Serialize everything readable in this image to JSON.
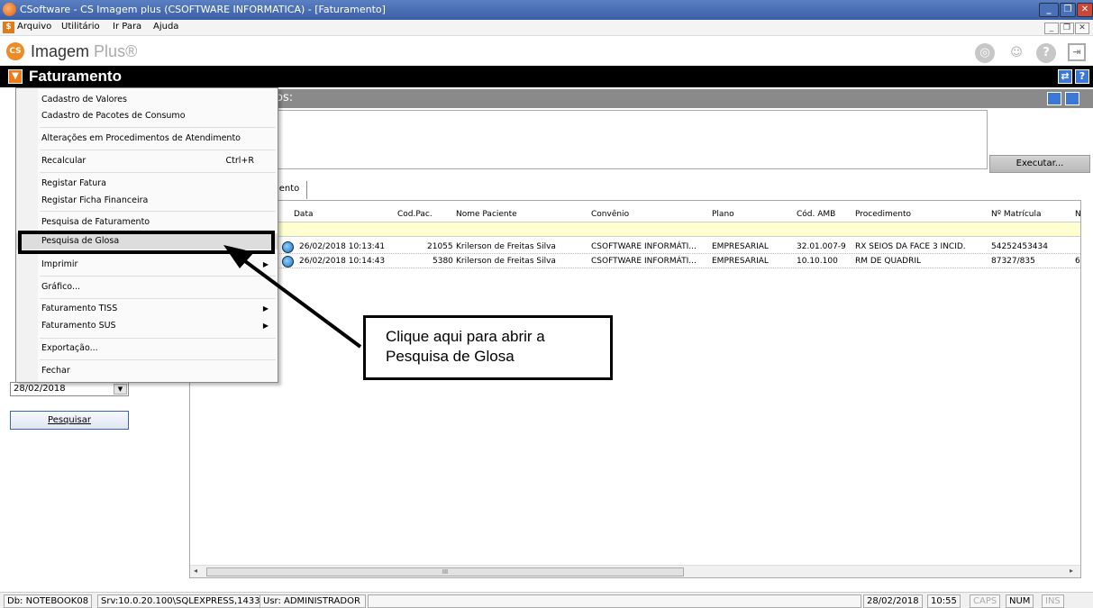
{
  "window": {
    "title": "CSoftware - CS Imagem plus (CSOFTWARE INFORMATICA) - [Faturamento]",
    "buttons": [
      "_",
      "❐",
      "✕"
    ]
  },
  "menubar": {
    "items": [
      "Arquivo",
      "Utilitário",
      "Ir Para",
      "Ajuda"
    ],
    "icon": "$",
    "mdi_buttons": [
      "_",
      "❐",
      "✕"
    ]
  },
  "brand": {
    "logo": "CS",
    "name": "Imagem",
    "plus": "Plus®",
    "icons": [
      "globe-icon",
      "user-icon",
      "help-icon",
      "exit-icon"
    ]
  },
  "module": {
    "title": "Faturamento",
    "buttons": [
      "⇄",
      "?"
    ]
  },
  "section": {
    "title": "os:"
  },
  "left_panel": {
    "date": "28/02/2018",
    "search_label": "Pesquisar"
  },
  "toolbar": {
    "execute_label": "Executar...",
    "tab_label": "mento"
  },
  "context_menu": {
    "items": [
      {
        "label": "Cadastro de Valores",
        "shortcut": "",
        "submenu": false
      },
      {
        "label": "Cadastro de Pacotes de Consumo",
        "shortcut": "",
        "submenu": false
      },
      {
        "label": "Alterações em Procedimentos de Atendimento",
        "shortcut": "",
        "submenu": false
      },
      {
        "label": "Recalcular",
        "shortcut": "Ctrl+R",
        "submenu": false
      },
      {
        "label": "Registar Fatura",
        "shortcut": "",
        "submenu": false
      },
      {
        "label": "Registar Ficha Financeira",
        "shortcut": "",
        "submenu": false
      },
      {
        "label": "Pesquisa de Faturamento",
        "shortcut": "",
        "submenu": false
      },
      {
        "label": "Pesquisa de Glosa",
        "shortcut": "",
        "submenu": false
      },
      {
        "label": "Imprimir",
        "shortcut": "",
        "submenu": true
      },
      {
        "label": "Gráfico...",
        "shortcut": "",
        "submenu": false
      },
      {
        "label": "Faturamento TISS",
        "shortcut": "",
        "submenu": true
      },
      {
        "label": "Faturamento SUS",
        "shortcut": "",
        "submenu": true
      },
      {
        "label": "Exportação...",
        "shortcut": "",
        "submenu": false
      },
      {
        "label": "Fechar",
        "shortcut": "",
        "submenu": false
      }
    ]
  },
  "callout": {
    "line1": "Clique aqui para abrir a",
    "line2": "Pesquisa de Glosa"
  },
  "grid": {
    "columns": [
      "Data",
      "Cod.Pac.",
      "Nome Paciente",
      "Convênio",
      "Plano",
      "Cód. AMB",
      "Procedimento",
      "Nº Matrícula",
      "N"
    ],
    "rows": [
      [
        "26/02/2018 10:13:41",
        "21055",
        "Krilerson de Freitas Silva",
        "CSOFTWARE INFORMÁTI...",
        "EMPRESARIAL",
        "32.01.007-9",
        "RX SEIOS DA FACE 3 INCID.",
        "54252453434",
        ""
      ],
      [
        "26/02/2018 10:14:43",
        "5380",
        "Krilerson de Freitas Silva",
        "CSOFTWARE INFORMÁTI...",
        "EMPRESARIAL",
        "10.10.100",
        "RM DE QUADRIL",
        "87327/835",
        "6"
      ]
    ],
    "scroll_grip": "III"
  },
  "statusbar": {
    "db": "Db: NOTEBOOK08",
    "srv": "Srv:10.0.20.100\\SQLEXPRESS,1433",
    "usr": "Usr: ADMINISTRADOR",
    "date": "28/02/2018",
    "time": "10:55",
    "caps": "CAPS",
    "num": "NUM",
    "ins": "INS"
  }
}
